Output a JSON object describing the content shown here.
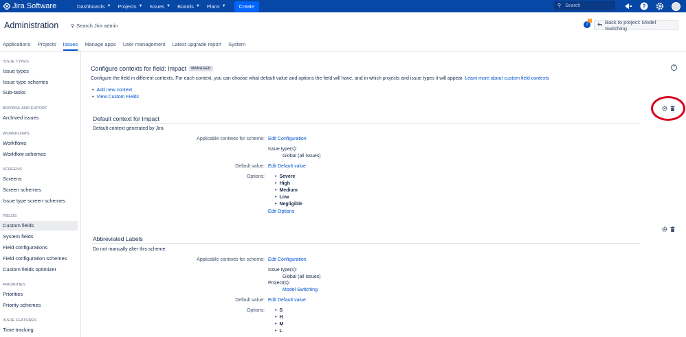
{
  "topnav": {
    "brand": "Jira Software",
    "items": [
      "Dashboards",
      "Projects",
      "Issues",
      "Boards",
      "Plans"
    ],
    "create_label": "Create",
    "search_placeholder": "Search"
  },
  "header": {
    "title": "Administration",
    "search_label": "Search Jira admin",
    "notification_count": "1",
    "back_label": "Back to project: Model Switching"
  },
  "tabs": [
    "Applications",
    "Projects",
    "Issues",
    "Manage apps",
    "User management",
    "Latest upgrade report",
    "System"
  ],
  "active_tab": "Issues",
  "sidebar": {
    "sections": [
      {
        "title": "ISSUE TYPES",
        "items": [
          "Issue types",
          "Issue type schemes",
          "Sub-tasks"
        ]
      },
      {
        "title": "BROWSE AND EXPORT",
        "items": [
          "Archived issues"
        ]
      },
      {
        "title": "WORKFLOWS",
        "items": [
          "Workflows",
          "Workflow schemes"
        ]
      },
      {
        "title": "SCREENS",
        "items": [
          "Screens",
          "Screen schemes",
          "Issue type screen schemes"
        ]
      },
      {
        "title": "FIELDS",
        "items": [
          "Custom fields",
          "System fields",
          "Field configurations",
          "Field configuration schemes",
          "Custom fields optimizer"
        ]
      },
      {
        "title": "PRIORITIES",
        "items": [
          "Priorities",
          "Priority schemes"
        ]
      },
      {
        "title": "ISSUE FEATURES",
        "items": [
          "Time tracking"
        ]
      }
    ],
    "active_item": "Custom fields"
  },
  "main": {
    "heading": "Configure contexts for field: Impact",
    "badge": "MANAGED",
    "description": "Configure the field in different contexts. For each context, you can choose what default value and options the field will have, and in which projects and issue types it will appear.",
    "learn_more": "Learn more about custom field contexts",
    "links": [
      "Add new context",
      "View Custom Fields"
    ],
    "contexts": [
      {
        "title": "Default context for Impact",
        "subtitle": "Default context generated by Jira",
        "applicable_label": "Applicable contexts for scheme:",
        "edit_config": "Edit Configuration",
        "issue_types_label": "Issue type(s):",
        "issue_types_value": "Global (all issues)",
        "default_label": "Default value:",
        "edit_default": "Edit Default value",
        "options_label": "Options:",
        "options": [
          "Severe",
          "High",
          "Medium",
          "Low",
          "Negligible"
        ],
        "edit_options": "Edit Options"
      },
      {
        "title": "Abbreviated Labels",
        "subtitle": "Do not manually alter this scheme.",
        "applicable_label": "Applicable contexts for scheme:",
        "edit_config": "Edit Configuration",
        "issue_types_label": "Issue type(s):",
        "issue_types_value": "Global (all issues)",
        "projects_label": "Project(s):",
        "projects_value": "Model Switching",
        "default_label": "Default value:",
        "edit_default": "Edit Default value",
        "options_label": "Options:",
        "options": [
          "S",
          "H",
          "M",
          "L"
        ]
      }
    ]
  },
  "colors": {
    "nav": "#0747a6",
    "link": "#0052cc",
    "annotation": "#d9001b"
  }
}
